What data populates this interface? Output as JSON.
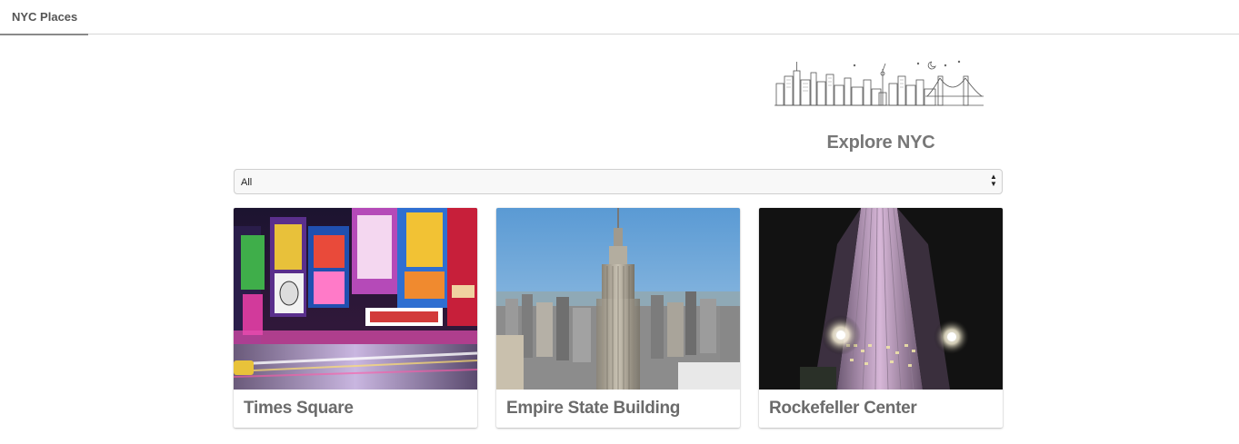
{
  "nav": {
    "tab_label": "NYC Places"
  },
  "header": {
    "title": "Explore NYC"
  },
  "filter": {
    "selected": "All"
  },
  "cards": [
    {
      "title": "Times Square"
    },
    {
      "title": "Empire State Building"
    },
    {
      "title": "Rockefeller Center"
    }
  ],
  "colors": {
    "title_text": "#777777",
    "card_title_text": "#6b6b6b",
    "select_bg": "#f8f8f8"
  }
}
